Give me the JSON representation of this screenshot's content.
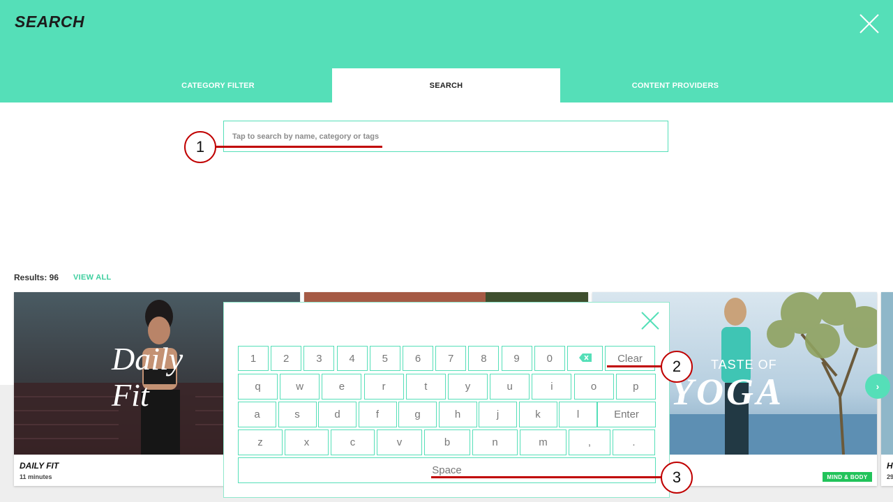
{
  "header": {
    "title": "SEARCH",
    "tabs": [
      {
        "label": "CATEGORY FILTER"
      },
      {
        "label": "SEARCH"
      },
      {
        "label": "CONTENT PROVIDERS"
      }
    ]
  },
  "search": {
    "placeholder": "Tap to search by name, category or tags",
    "value": ""
  },
  "results": {
    "label": "Results: 96",
    "view_all": "VIEW ALL"
  },
  "cards": [
    {
      "title": "DAILY FIT",
      "subtitle": "11 minutes",
      "image_text": "Daily Fit"
    },
    {
      "title": "",
      "subtitle": ""
    },
    {
      "title": "",
      "subtitle": "",
      "tag": "MIND & BODY",
      "image_text_top": "TASTE OF",
      "image_text_bottom": "YOGA"
    },
    {
      "title": "H",
      "subtitle": "29"
    }
  ],
  "keyboard": {
    "row1": [
      "1",
      "2",
      "3",
      "4",
      "5",
      "6",
      "7",
      "8",
      "9",
      "0"
    ],
    "backspace_icon": "backspace-icon",
    "clear": "Clear",
    "row2": [
      "q",
      "w",
      "e",
      "r",
      "t",
      "y",
      "u",
      "i",
      "o",
      "p"
    ],
    "row3": [
      "a",
      "s",
      "d",
      "f",
      "g",
      "h",
      "j",
      "k",
      "l"
    ],
    "enter": "Enter",
    "row4": [
      "z",
      "x",
      "c",
      "v",
      "b",
      "n",
      "m",
      ",",
      "."
    ],
    "space": "Space"
  },
  "annotations": [
    "1",
    "2",
    "3"
  ],
  "colors": {
    "accent": "#55dfb8",
    "annotation": "#c00000",
    "tag": "#21c35a"
  }
}
